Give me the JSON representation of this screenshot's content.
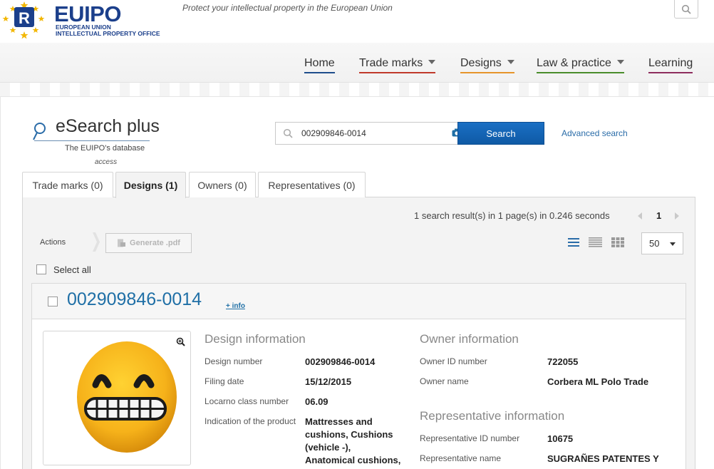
{
  "header": {
    "logo_word": "EUIPO",
    "logo_sub_line1": "EUROPEAN UNION",
    "logo_sub_line2": "INTELLECTUAL PROPERTY OFFICE",
    "tagline": "Protect your intellectual property in the European Union"
  },
  "nav": {
    "home": "Home",
    "trade_marks": "Trade marks",
    "designs": "Designs",
    "law_practice": "Law & practice",
    "learning": "Learning"
  },
  "esearch": {
    "title": "eSearch plus",
    "subtitle": "The EUIPO's database",
    "subtitle2": "access",
    "query": "002909846-0014",
    "search_label": "Search",
    "advanced_label": "Advanced search"
  },
  "tabs": [
    {
      "label": "Trade marks (0)"
    },
    {
      "label": "Designs (1)"
    },
    {
      "label": "Owners (0)"
    },
    {
      "label": "Representatives (0)"
    }
  ],
  "results": {
    "summary": "1 search result(s) in 1 page(s) in 0.246 seconds",
    "page": "1",
    "actions_label": "Actions",
    "pdf_label": "Generate .pdf",
    "per_page": "50",
    "select_all": "Select all"
  },
  "card": {
    "title": "002909846-0014",
    "info_link": "+ info",
    "design_info": {
      "heading": "Design information",
      "design_number_label": "Design number",
      "design_number": "002909846-0014",
      "filing_date_label": "Filing date",
      "filing_date": "15/12/2015",
      "locarno_label": "Locarno class number",
      "locarno": "06.09",
      "indication_label": "Indication of the product",
      "indication_1": "Mattresses and",
      "indication_2": "cushions, Cushions",
      "indication_3": "(vehicle -),",
      "indication_4": "Anatomical cushions,"
    },
    "owner_info": {
      "heading": "Owner information",
      "owner_id_label": "Owner ID number",
      "owner_id": "722055",
      "owner_name_label": "Owner name",
      "owner_name": "Corbera ML Polo Trade"
    },
    "rep_info": {
      "heading": "Representative information",
      "rep_id_label": "Representative ID number",
      "rep_id": "10675",
      "rep_name_label": "Representative name",
      "rep_name": "SUGRAÑES PATENTES Y"
    }
  },
  "colors": {
    "brand_blue": "#1b3f8b",
    "link_blue": "#1f6fa6",
    "search_button": "#1565b8",
    "emoji_yellow": "#f6b21a"
  }
}
